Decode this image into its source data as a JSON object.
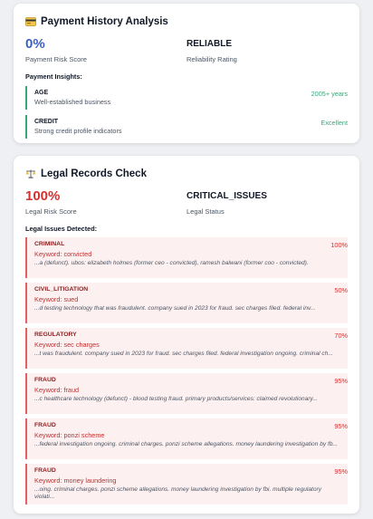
{
  "payment": {
    "title": "Payment History Analysis",
    "score_value": "0%",
    "score_label": "Payment Risk Score",
    "rating_value": "RELIABLE",
    "rating_label": "Reliability Rating",
    "insights_heading": "Payment Insights:",
    "insights": [
      {
        "name": "AGE",
        "desc": "Well-established business",
        "value": "2005+ years"
      },
      {
        "name": "CREDIT",
        "desc": "Strong credit profile indicators",
        "value": "Excellent"
      }
    ]
  },
  "legal": {
    "title": "Legal Records Check",
    "score_value": "100%",
    "score_label": "Legal Risk Score",
    "status_value": "CRITICAL_ISSUES",
    "status_label": "Legal Status",
    "issues_heading": "Legal Issues Detected:",
    "issues": [
      {
        "category": "CRIMINAL",
        "keyword": "Keyword: convicted",
        "snippet": "...a (defunct). ubos: elizabeth holmes (former ceo - convicted), ramesh balwani (former coo - convicted).",
        "pct": "100%"
      },
      {
        "category": "CIVIL_LITIGATION",
        "keyword": "Keyword: sued",
        "snippet": "...d testing technology that was fraudulent. company sued in 2023 for fraud. sec charges filed. federal inv...",
        "pct": "50%"
      },
      {
        "category": "REGULATORY",
        "keyword": "Keyword: sec charges",
        "snippet": "...t was fraudulent. company sued in 2023 for fraud. sec charges filed. federal investigation ongoing. criminal ch...",
        "pct": "70%"
      },
      {
        "category": "FRAUD",
        "keyword": "Keyword: fraud",
        "snippet": "...c healthcare technology (defunct) - blood testing fraud. primary products/services: claimed revolutionary...",
        "pct": "95%"
      },
      {
        "category": "FRAUD",
        "keyword": "Keyword: ponzi scheme",
        "snippet": "...federal investigation ongoing. criminal charges. ponzi scheme allegations. money laundering investigation by fb...",
        "pct": "95%"
      },
      {
        "category": "FRAUD",
        "keyword": "Keyword: money laundering",
        "snippet": "...oing. criminal charges. ponzi scheme allegations. money laundering investigation by fbi. multiple regulatory violati...",
        "pct": "95%"
      }
    ]
  },
  "icons": {
    "payment": "credit-card-icon",
    "legal": "balance-scale-icon"
  },
  "colors": {
    "green": "#3aa77a",
    "red": "#d53030",
    "blue": "#3b5fc0"
  }
}
